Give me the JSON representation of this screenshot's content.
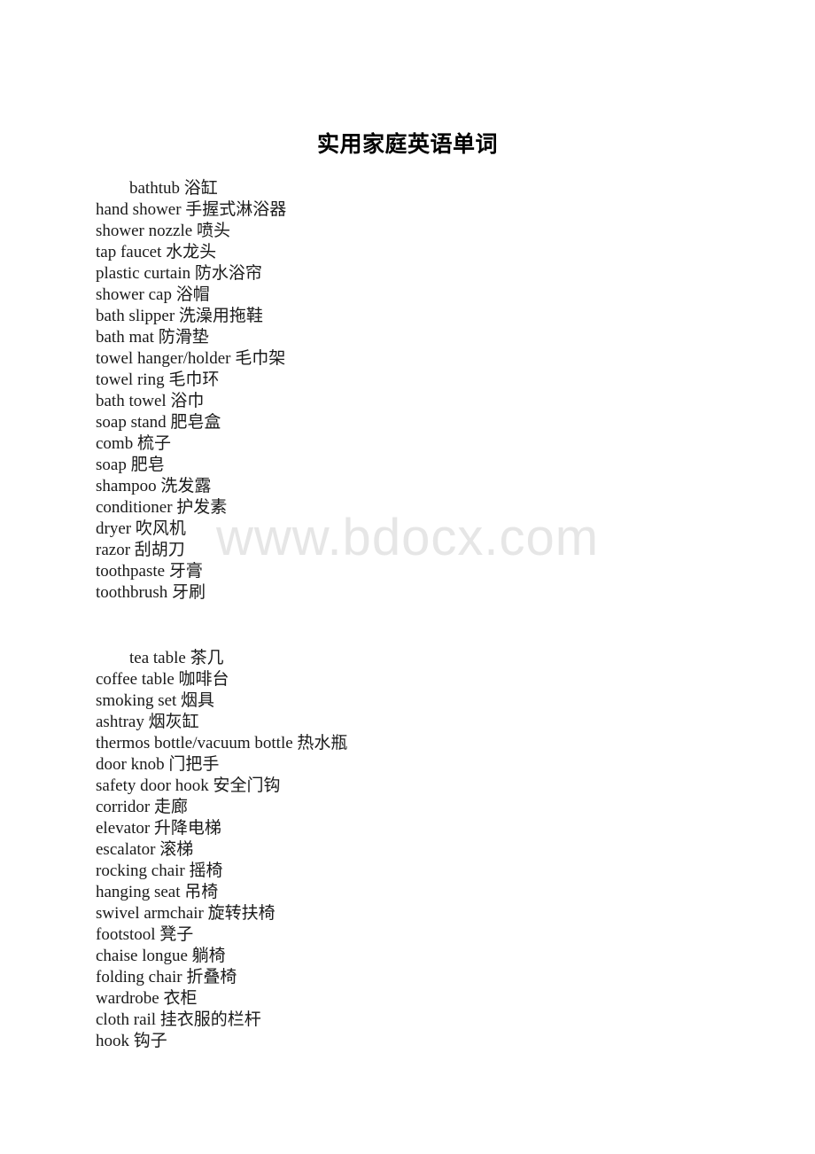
{
  "document": {
    "title": "实用家庭英语单词",
    "watermark": "www.bdocx.com",
    "background_color": "#ffffff",
    "text_color": "#1a1a1a",
    "watermark_color": "#e6e6e6"
  },
  "blocks": [
    {
      "name": "bathroom-vocabulary",
      "lines": [
        "bathtub 浴缸",
        "hand shower 手握式淋浴器",
        "shower nozzle 喷头",
        "tap faucet 水龙头",
        "plastic curtain 防水浴帘",
        "shower cap 浴帽",
        "bath slipper 洗澡用拖鞋",
        "bath mat 防滑垫",
        "towel hanger/holder 毛巾架",
        "towel ring 毛巾环",
        "bath towel 浴巾",
        "soap stand 肥皂盒",
        "comb 梳子",
        "soap 肥皂",
        "shampoo 洗发露",
        "conditioner 护发素",
        "dryer 吹风机",
        "razor 刮胡刀",
        "toothpaste 牙膏",
        "toothbrush 牙刷"
      ]
    },
    {
      "name": "living-room-vocabulary",
      "lines": [
        "tea table 茶几",
        "coffee table 咖啡台",
        "smoking set 烟具",
        "ashtray 烟灰缸",
        "thermos bottle/vacuum bottle 热水瓶",
        "door knob 门把手",
        "safety door hook 安全门钩",
        "corridor 走廊",
        "elevator 升降电梯",
        "escalator 滚梯",
        "rocking chair 摇椅",
        "hanging seat 吊椅",
        "swivel armchair 旋转扶椅",
        "footstool 凳子",
        "chaise longue 躺椅",
        "folding chair 折叠椅",
        "wardrobe 衣柜",
        "cloth rail 挂衣服的栏杆",
        "hook 钩子"
      ]
    }
  ]
}
